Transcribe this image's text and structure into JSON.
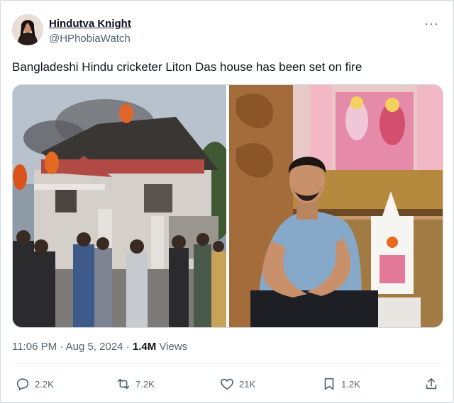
{
  "author": {
    "display_name": "Hindutva Knight",
    "handle": "@HPhobiaWatch"
  },
  "more_icon": "more-horizontal-icon",
  "tweet": {
    "text": "Bangladeshi Hindu cricketer Liton Das house has been set on fire"
  },
  "media": {
    "left_photo": "house-on-fire-photo",
    "right_photo": "man-seated-near-shrine-photo"
  },
  "meta": {
    "time": "11:06 PM",
    "separator": "·",
    "date": "Aug 5, 2024",
    "separator2": "·",
    "views_count": "1.4M",
    "views_label": "Views"
  },
  "actions": {
    "reply": {
      "icon": "reply-icon",
      "count": "2.2K"
    },
    "retweet": {
      "icon": "retweet-icon",
      "count": "7.2K"
    },
    "like": {
      "icon": "heart-icon",
      "count": "21K"
    },
    "bookmark": {
      "icon": "bookmark-icon",
      "count": "1.2K"
    },
    "share": {
      "icon": "share-icon"
    }
  },
  "colors": {
    "text": "#0f1419",
    "secondary": "#536471",
    "border": "#cfd9de"
  }
}
